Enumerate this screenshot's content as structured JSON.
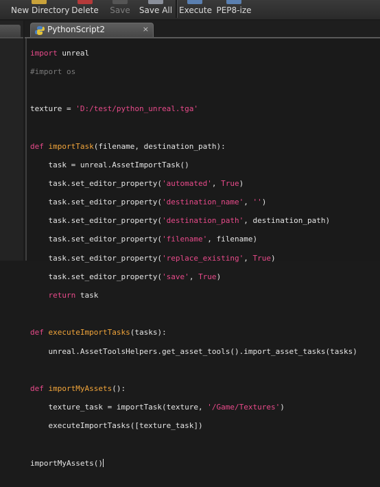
{
  "toolbar": {
    "buttons": [
      {
        "label": "New Directory",
        "icon": "folder-plus-icon",
        "enabled": true
      },
      {
        "label": "Delete",
        "icon": "delete-icon",
        "enabled": true
      },
      {
        "label": "Save",
        "icon": "save-icon",
        "enabled": false
      },
      {
        "label": "Save All",
        "icon": "save-all-icon",
        "enabled": true
      },
      {
        "label": "Execute",
        "icon": "execute-icon",
        "enabled": true
      },
      {
        "label": "PEP8-ize",
        "icon": "pep8-icon",
        "enabled": true
      }
    ]
  },
  "editor": {
    "tab_title": "PythonScript2",
    "tab_close": "×",
    "code": {
      "l1_kw": "import",
      "l1_rest": " unreal",
      "l2": "#import os",
      "l4_a": "texture = ",
      "l4_str": "'D:/test/python_unreal.tga'",
      "l6_kw": "def",
      "l6_fn": "importTask",
      "l6_rest": "(filename, destination_path):",
      "l7": "    task = unreal.AssetImportTask()",
      "l8_a": "    task.set_editor_property(",
      "l8_str": "'automated'",
      "l8_b": ", ",
      "l8_kw": "True",
      "l8_c": ")",
      "l9_a": "    task.set_editor_property(",
      "l9_str": "'destination_name'",
      "l9_b": ", ",
      "l9_str2": "''",
      "l9_c": ")",
      "l10_a": "    task.set_editor_property(",
      "l10_str": "'destination_path'",
      "l10_b": ", destination_path)",
      "l11_a": "    task.set_editor_property(",
      "l11_str": "'filename'",
      "l11_b": ", filename)",
      "l12_a": "    task.set_editor_property(",
      "l12_str": "'replace_existing'",
      "l12_b": ", ",
      "l12_kw": "True",
      "l12_c": ")",
      "l13_a": "    task.set_editor_property(",
      "l13_str": "'save'",
      "l13_b": ", ",
      "l13_kw": "True",
      "l13_c": ")",
      "l14_ind": "    ",
      "l14_kw": "return",
      "l14_rest": " task",
      "l16_kw": "def",
      "l16_fn": "executeImportTasks",
      "l16_rest": "(tasks):",
      "l17": "    unreal.AssetToolsHelpers.get_asset_tools().import_asset_tasks(tasks)",
      "l19_kw": "def",
      "l19_fn": "importMyAssets",
      "l19_rest": "():",
      "l20_a": "    texture_task = importTask(texture, ",
      "l20_str": "'/Game/Textures'",
      "l20_b": ")",
      "l21": "    executeImportTasks([texture_task])",
      "l23": "importMyAssets()"
    }
  },
  "colors": {
    "keyword": "#e84a8a",
    "function": "#f2a53a",
    "string": "#e84a8a",
    "comment": "#7a7a7a",
    "text": "#e6e6e6",
    "background": "#1a1a1a"
  }
}
